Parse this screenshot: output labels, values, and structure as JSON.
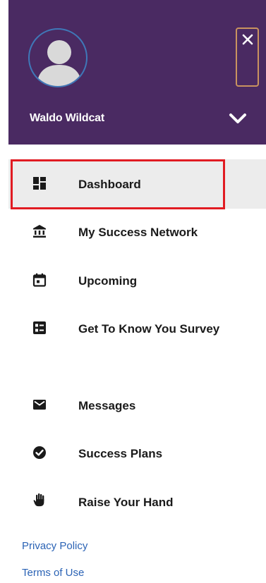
{
  "header": {
    "user_name": "Waldo Wildcat",
    "colors": {
      "background": "#4a2a62",
      "close_border": "#c9935f",
      "avatar_ring": "#3f78b8"
    },
    "icons": {
      "avatar": "person-silhouette-icon",
      "close": "close-icon",
      "expand": "chevron-down-icon"
    }
  },
  "nav": {
    "items": [
      {
        "label": "Dashboard",
        "icon": "dashboard-icon",
        "active": true
      },
      {
        "label": "My Success Network",
        "icon": "institution-icon"
      },
      {
        "label": "Upcoming",
        "icon": "calendar-icon"
      },
      {
        "label": "Get To Know You Survey",
        "icon": "survey-icon"
      },
      {
        "label": "Messages",
        "icon": "envelope-icon"
      },
      {
        "label": "Success Plans",
        "icon": "check-circle-icon"
      },
      {
        "label": "Raise Your Hand",
        "icon": "hand-icon"
      }
    ],
    "colors": {
      "active_background": "#ececec",
      "focus_outline": "#e11b22"
    }
  },
  "footer": {
    "privacy_label": "Privacy Policy",
    "terms_label": "Terms of Use",
    "link_color": "#2b63b5"
  }
}
